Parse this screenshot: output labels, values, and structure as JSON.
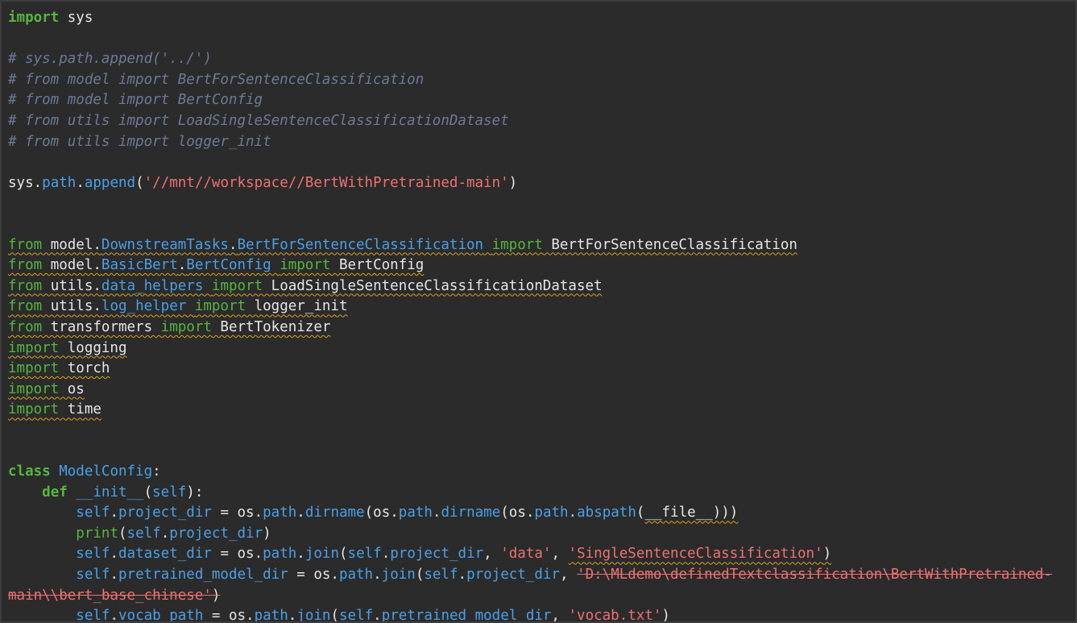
{
  "lines": [
    [
      {
        "t": "import",
        "c": "kw"
      },
      {
        "t": " sys",
        "c": "pl"
      }
    ],
    [],
    [
      {
        "t": "# sys.path.append('../')",
        "c": "cm"
      }
    ],
    [
      {
        "t": "# from model import BertForSentenceClassification",
        "c": "cm"
      }
    ],
    [
      {
        "t": "# from model import BertConfig",
        "c": "cm"
      }
    ],
    [
      {
        "t": "# from utils import LoadSingleSentenceClassificationDataset",
        "c": "cm"
      }
    ],
    [
      {
        "t": "# from utils import logger_init",
        "c": "cm"
      }
    ],
    [],
    [
      {
        "t": "sys",
        "c": "pl"
      },
      {
        "t": ".",
        "c": "pl"
      },
      {
        "t": "path",
        "c": "attr"
      },
      {
        "t": ".",
        "c": "pl"
      },
      {
        "t": "append",
        "c": "fn"
      },
      {
        "t": "(",
        "c": "pl"
      },
      {
        "t": "'//mnt//workspace//BertWithPretrained-main'",
        "c": "st"
      },
      {
        "t": ")",
        "c": "pl"
      }
    ],
    [],
    [],
    [
      {
        "t": "from",
        "c": "kw2",
        "w": true
      },
      {
        "t": " model.",
        "c": "pl",
        "w": true
      },
      {
        "t": "DownstreamTasks",
        "c": "attr",
        "w": true
      },
      {
        "t": ".",
        "c": "pl",
        "w": true
      },
      {
        "t": "BertForSentenceClassification",
        "c": "attr",
        "w": true
      },
      {
        "t": " ",
        "c": "pl",
        "w": true
      },
      {
        "t": "import",
        "c": "kw2",
        "w": true
      },
      {
        "t": " BertForSentenceClassification",
        "c": "pl",
        "w": true
      }
    ],
    [
      {
        "t": "from",
        "c": "kw2",
        "w": true
      },
      {
        "t": " model.",
        "c": "pl",
        "w": true
      },
      {
        "t": "BasicBert",
        "c": "attr",
        "w": true
      },
      {
        "t": ".",
        "c": "pl",
        "w": true
      },
      {
        "t": "BertConfig",
        "c": "attr",
        "w": true
      },
      {
        "t": " ",
        "c": "pl",
        "w": true
      },
      {
        "t": "import",
        "c": "kw2",
        "w": true
      },
      {
        "t": " BertConfig",
        "c": "pl",
        "w": true
      }
    ],
    [
      {
        "t": "from",
        "c": "kw2",
        "w": true
      },
      {
        "t": " utils.",
        "c": "pl",
        "w": true
      },
      {
        "t": "data_helpers",
        "c": "attr",
        "w": true
      },
      {
        "t": " ",
        "c": "pl",
        "w": true
      },
      {
        "t": "import",
        "c": "kw2",
        "w": true
      },
      {
        "t": " LoadSingleSentenceClassificationDataset",
        "c": "pl",
        "w": true
      }
    ],
    [
      {
        "t": "from",
        "c": "kw2",
        "w": true
      },
      {
        "t": " utils.",
        "c": "pl",
        "w": true
      },
      {
        "t": "log_helper",
        "c": "attr",
        "w": true
      },
      {
        "t": " ",
        "c": "pl",
        "w": true
      },
      {
        "t": "import",
        "c": "kw2",
        "w": true
      },
      {
        "t": " logger_init",
        "c": "pl",
        "w": true
      }
    ],
    [
      {
        "t": "from",
        "c": "kw2",
        "w": true
      },
      {
        "t": " transformers ",
        "c": "pl",
        "w": true
      },
      {
        "t": "import",
        "c": "kw2",
        "w": true
      },
      {
        "t": " BertTokenizer",
        "c": "pl",
        "w": true
      }
    ],
    [
      {
        "t": "import",
        "c": "kw2",
        "w": true
      },
      {
        "t": " logging",
        "c": "pl",
        "w": true
      }
    ],
    [
      {
        "t": "import",
        "c": "kw2",
        "w": true
      },
      {
        "t": " torch",
        "c": "pl",
        "w": true
      }
    ],
    [
      {
        "t": "import",
        "c": "kw2",
        "w": true
      },
      {
        "t": " os",
        "c": "pl",
        "w": true
      }
    ],
    [
      {
        "t": "import",
        "c": "kw2",
        "w": true
      },
      {
        "t": " time",
        "c": "pl",
        "w": true
      }
    ],
    [],
    [],
    [
      {
        "t": "class",
        "c": "kw"
      },
      {
        "t": " ",
        "c": "pl"
      },
      {
        "t": "ModelConfig",
        "c": "fn"
      },
      {
        "t": ":",
        "c": "pl"
      }
    ],
    [
      {
        "t": "    ",
        "c": "pl"
      },
      {
        "t": "def",
        "c": "kw"
      },
      {
        "t": " __init__",
        "c": "fn"
      },
      {
        "t": "(",
        "c": "pl"
      },
      {
        "t": "self",
        "c": "self"
      },
      {
        "t": "):",
        "c": "pl"
      }
    ],
    [
      {
        "t": "        ",
        "c": "pl"
      },
      {
        "t": "self",
        "c": "self"
      },
      {
        "t": ".",
        "c": "pl"
      },
      {
        "t": "project_dir",
        "c": "attr"
      },
      {
        "t": " = ",
        "c": "pl"
      },
      {
        "t": "os",
        "c": "pl"
      },
      {
        "t": ".",
        "c": "pl"
      },
      {
        "t": "path",
        "c": "attr"
      },
      {
        "t": ".",
        "c": "pl"
      },
      {
        "t": "dirname",
        "c": "fn"
      },
      {
        "t": "(",
        "c": "pl"
      },
      {
        "t": "os",
        "c": "pl"
      },
      {
        "t": ".",
        "c": "pl"
      },
      {
        "t": "path",
        "c": "attr"
      },
      {
        "t": ".",
        "c": "pl"
      },
      {
        "t": "dirname",
        "c": "fn"
      },
      {
        "t": "(",
        "c": "pl"
      },
      {
        "t": "os",
        "c": "pl"
      },
      {
        "t": ".",
        "c": "pl"
      },
      {
        "t": "path",
        "c": "attr"
      },
      {
        "t": ".",
        "c": "pl"
      },
      {
        "t": "abspath",
        "c": "fn"
      },
      {
        "t": "(",
        "c": "pl"
      },
      {
        "t": "__file__",
        "c": "pl",
        "w": true
      },
      {
        "t": ")))",
        "c": "pl",
        "w": true
      }
    ],
    [
      {
        "t": "        ",
        "c": "pl"
      },
      {
        "t": "print",
        "c": "bi"
      },
      {
        "t": "(",
        "c": "pl"
      },
      {
        "t": "self",
        "c": "self"
      },
      {
        "t": ".",
        "c": "pl"
      },
      {
        "t": "project_dir",
        "c": "attr"
      },
      {
        "t": ")",
        "c": "pl"
      }
    ],
    [
      {
        "t": "        ",
        "c": "pl"
      },
      {
        "t": "self",
        "c": "self"
      },
      {
        "t": ".",
        "c": "pl"
      },
      {
        "t": "dataset_dir",
        "c": "attr"
      },
      {
        "t": " = ",
        "c": "pl"
      },
      {
        "t": "os",
        "c": "pl"
      },
      {
        "t": ".",
        "c": "pl"
      },
      {
        "t": "path",
        "c": "attr"
      },
      {
        "t": ".",
        "c": "pl"
      },
      {
        "t": "join",
        "c": "fn"
      },
      {
        "t": "(",
        "c": "pl"
      },
      {
        "t": "self",
        "c": "self"
      },
      {
        "t": ".",
        "c": "pl"
      },
      {
        "t": "project_dir",
        "c": "attr"
      },
      {
        "t": ", ",
        "c": "pl"
      },
      {
        "t": "'data'",
        "c": "st"
      },
      {
        "t": ", ",
        "c": "pl"
      },
      {
        "t": "'SingleSentenceClassification'",
        "c": "st",
        "w": true
      },
      {
        "t": ")",
        "c": "pl",
        "w": true
      }
    ],
    [
      {
        "t": "        ",
        "c": "pl"
      },
      {
        "t": "self",
        "c": "self"
      },
      {
        "t": ".",
        "c": "pl"
      },
      {
        "t": "pretrained_model_dir",
        "c": "attr"
      },
      {
        "t": " = ",
        "c": "pl"
      },
      {
        "t": "os",
        "c": "pl"
      },
      {
        "t": ".",
        "c": "pl"
      },
      {
        "t": "path",
        "c": "attr"
      },
      {
        "t": ".",
        "c": "pl"
      },
      {
        "t": "join",
        "c": "fn"
      },
      {
        "t": "(",
        "c": "pl"
      },
      {
        "t": "self",
        "c": "self"
      },
      {
        "t": ".",
        "c": "pl"
      },
      {
        "t": "project_dir",
        "c": "attr"
      },
      {
        "t": ", ",
        "c": "pl"
      },
      {
        "t": "'D:\\MLdemo\\definedTextclassification\\BertWithPretrained-",
        "c": "st",
        "s": true
      }
    ],
    [
      {
        "t": "main\\\\bert_base_chinese'",
        "c": "st",
        "s": true
      },
      {
        "t": ")",
        "c": "pl",
        "s": true
      }
    ],
    [
      {
        "t": "        ",
        "c": "pl"
      },
      {
        "t": "self",
        "c": "self"
      },
      {
        "t": ".",
        "c": "pl"
      },
      {
        "t": "vocab_path",
        "c": "attr"
      },
      {
        "t": " = ",
        "c": "pl"
      },
      {
        "t": "os",
        "c": "pl"
      },
      {
        "t": ".",
        "c": "pl"
      },
      {
        "t": "path",
        "c": "attr"
      },
      {
        "t": ".",
        "c": "pl"
      },
      {
        "t": "join",
        "c": "fn"
      },
      {
        "t": "(",
        "c": "pl"
      },
      {
        "t": "self",
        "c": "self"
      },
      {
        "t": ".",
        "c": "pl"
      },
      {
        "t": "pretrained_model_dir",
        "c": "attr"
      },
      {
        "t": ", ",
        "c": "pl"
      },
      {
        "t": "'vocab.txt'",
        "c": "st"
      },
      {
        "t": ")",
        "c": "pl"
      }
    ]
  ]
}
